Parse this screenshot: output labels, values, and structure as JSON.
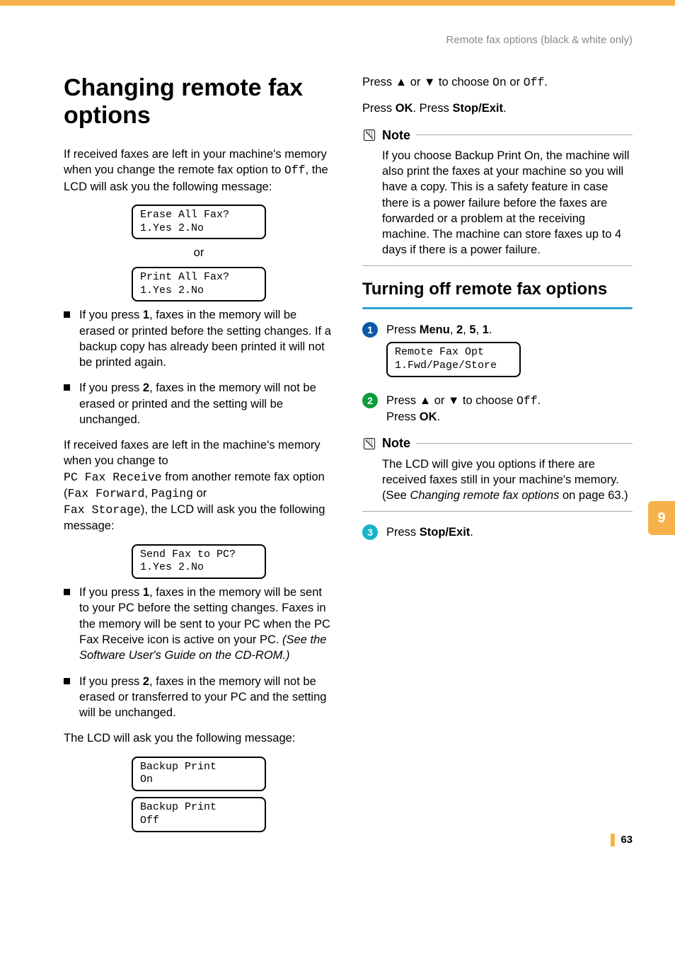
{
  "running_head": "Remote fax options (black & white only)",
  "h1": "Changing remote fax options",
  "intro1_a": "If received faxes are left in your machine's memory when you change the remote fax option to ",
  "intro1_mono": "Off",
  "intro1_b": ", the LCD will ask you the following message:",
  "lcd_erase": "Erase All Fax?\n1.Yes 2.No",
  "or_text": "or",
  "lcd_print": "Print All Fax?\n1.Yes 2.No",
  "bullet1a": "If you press ",
  "bullet1b": "1",
  "bullet1c": ", faxes in the memory will be erased or printed before the setting changes. If a backup copy has already been printed it will not be printed again.",
  "bullet2a": "If you press ",
  "bullet2b": "2",
  "bullet2c": ", faxes in the memory will not be erased or printed and the setting will be unchanged.",
  "pcfax_p1": "If received faxes are left in the machine's memory when you change to",
  "pcfax_m1": "PC Fax Receive",
  "pcfax_p2": " from another remote fax option (",
  "pcfax_m2": "Fax Forward",
  "pcfax_p3": ", ",
  "pcfax_m3": "Paging",
  "pcfax_p4": " or ",
  "pcfax_m4": "Fax Storage",
  "pcfax_p5": "), the LCD will ask you the following message:",
  "lcd_sendpc": "Send Fax to PC?\n1.Yes 2.No",
  "bullet3a": "If you press ",
  "bullet3b": "1",
  "bullet3c": ", faxes in the memory will be sent to your PC before the setting changes. Faxes in the memory will be sent to your PC when the PC Fax Receive icon is active on your PC. ",
  "bullet3d": "(See the Software User's Guide on the CD-ROM.)",
  "bullet4a": "If you press ",
  "bullet4b": "2",
  "bullet4c": ", faxes in the memory will not be erased or transferred to your PC and the setting will be unchanged.",
  "askmsg": "The LCD will ask you the following message:",
  "lcd_bp_on": "Backup Print\nOn",
  "lcd_bp_off": "Backup Print\nOff",
  "right_p1a": "Press  ",
  "arrow_up": "▲",
  "right_p1b": " or ",
  "arrow_down": "▼",
  "right_p1c": " to choose ",
  "right_m_on": "On",
  "right_p1d": " or ",
  "right_m_off": "Off",
  "right_p1e": ".",
  "right_p2a": "Press ",
  "right_p2b": "OK",
  "right_p2c": ". Press ",
  "right_p2d": "Stop/Exit",
  "right_p2e": ".",
  "note_label": "Note",
  "note1": "If you choose Backup Print On, the machine will also print the faxes at your machine so you will have a copy. This is a safety feature in case there is a power failure before the faxes are forwarded or a problem at the receiving machine. The machine can store faxes up to 4 days if there is a power failure.",
  "h2": "Turning off remote fax options",
  "step1a": "Press ",
  "step1b": "Menu",
  "step1c": ", ",
  "step1d": "2",
  "step1e": ", ",
  "step1f": "5",
  "step1g": ", ",
  "step1h": "1",
  "step1i": ".",
  "lcd_remote": "Remote Fax Opt\n1.Fwd/Page/Store",
  "step2a": "Press ",
  "step2b": " or ",
  "step2c": " to choose ",
  "step2m": "Off",
  "step2d": ".",
  "step2e": "Press ",
  "step2f": "OK",
  "step2g": ".",
  "note2a": "The LCD will give you options if there are received faxes still in your machine's memory. (See ",
  "note2b": "Changing remote fax options",
  "note2c": " on page 63.)",
  "step3a": "Press ",
  "step3b": "Stop/Exit",
  "step3c": ".",
  "tab_number": "9",
  "page_number": "63",
  "badge1": "1",
  "badge2": "2",
  "badge3": "3"
}
